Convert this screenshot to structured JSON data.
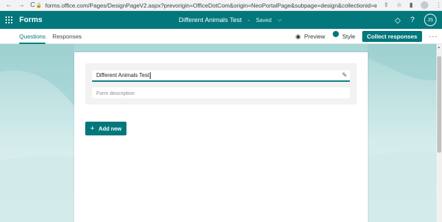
{
  "browser": {
    "url": "forms.office.com/Pages/DesignPageV2.aspx?prevorigin=OfficeDotCom&origin=NeoPortalPage&subpage=design&collectionid=ewa70ffb2ns8wm3gav1j4...",
    "back_icon": "←",
    "forward_icon": "→",
    "reload_icon": "C"
  },
  "topbar": {
    "app_name": "Forms",
    "form_title": "Different Animals Test",
    "separator": "-",
    "status": "Saved",
    "chevron": "⌵",
    "user_initials": "JS",
    "help_icon": "?"
  },
  "subbar": {
    "tabs": [
      {
        "label": "Questions",
        "active": true
      },
      {
        "label": "Responses",
        "active": false
      }
    ],
    "preview_label": "Preview",
    "style_label": "Style",
    "collect_label": "Collect responses",
    "more_label": "···"
  },
  "form": {
    "title_value": "Different Animals Test",
    "description_placeholder": "Form description",
    "add_new_label": "Add new"
  },
  "colors": {
    "brand": "#03787c",
    "background_top": "#a9d6d6",
    "background_bottom": "#e7f4f4"
  }
}
